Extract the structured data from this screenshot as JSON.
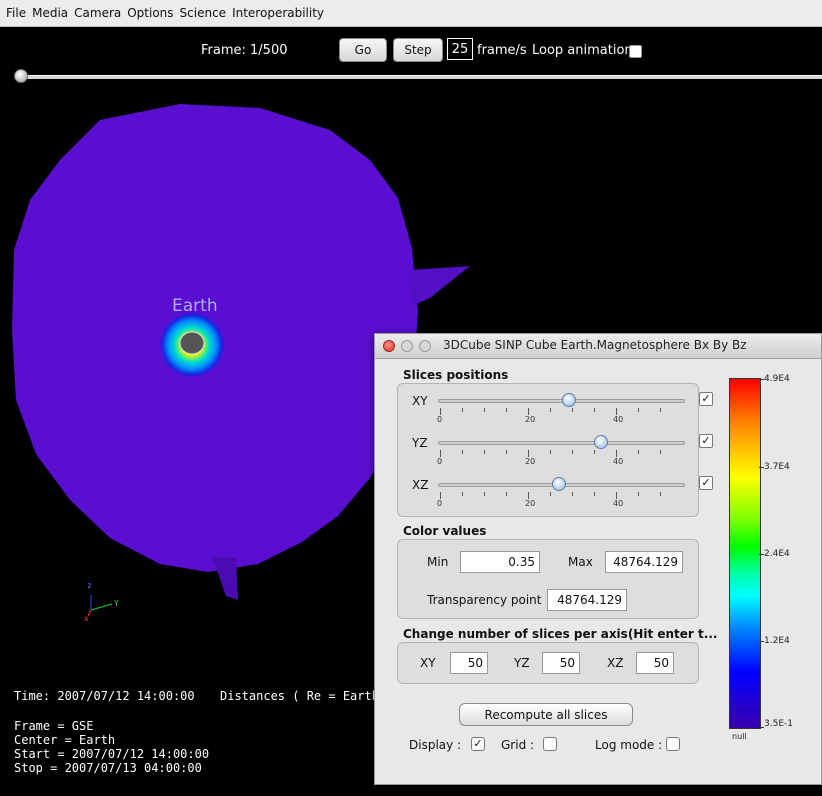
{
  "menu": [
    "File",
    "Media",
    "Camera",
    "Options",
    "Science",
    "Interoperability"
  ],
  "toolbar": {
    "frame_label": "Frame: 1/500",
    "go_label": "Go",
    "step_label": "Step",
    "fps_value": "25",
    "fps_unit": "frame/s",
    "loop_label": "Loop animation",
    "loop_checked": false,
    "timeline_position": 0.0
  },
  "scene": {
    "earth_label": "Earth",
    "axis_z": "z",
    "axis_y": "Y",
    "axis_x": "x",
    "colors": {
      "plane": "#5a0fd0",
      "edge": "#4a08b8",
      "background": "#000000"
    }
  },
  "info": {
    "time": "Time: 2007/07/12 14:00:00",
    "distances": "Distances ( Re = Earth rad",
    "frame": "Frame = GSE",
    "center": "Center = Earth",
    "start": "Start = 2007/07/12 14:00:00",
    "stop": "Stop = 2007/07/13 04:00:00"
  },
  "dialog": {
    "title": "3DCube SINP Cube Earth.Magnetosphere  Bx By Bz",
    "slices_title": "Slices positions",
    "sliders": [
      {
        "axis": "XY",
        "value": 0.53,
        "checked": true
      },
      {
        "axis": "YZ",
        "value": 0.66,
        "checked": true
      },
      {
        "axis": "XZ",
        "value": 0.49,
        "checked": true
      }
    ],
    "tick_labels": [
      "0",
      "20",
      "40"
    ],
    "color_title": "Color values",
    "min_label": "Min",
    "min_value": "0.35",
    "max_label": "Max",
    "max_value": "48764.129",
    "transparency_label": "Transparency point",
    "transparency_value": "48764.129",
    "change_title": "Change number of slices per axis(Hit enter t...",
    "slices": [
      {
        "label": "XY",
        "value": "50"
      },
      {
        "label": "YZ",
        "value": "50"
      },
      {
        "label": "XZ",
        "value": "50"
      }
    ],
    "recompute_label": "Recompute all slices",
    "display_label": "Display :",
    "display_checked": true,
    "grid_label": "Grid :",
    "grid_checked": false,
    "log_label": "Log mode :",
    "log_checked": false,
    "colorbar_labels": [
      "4.9E4",
      "3.7E4",
      "2.4E4",
      "1.2E4",
      "3.5E-1"
    ],
    "colorbar_null": "null"
  }
}
